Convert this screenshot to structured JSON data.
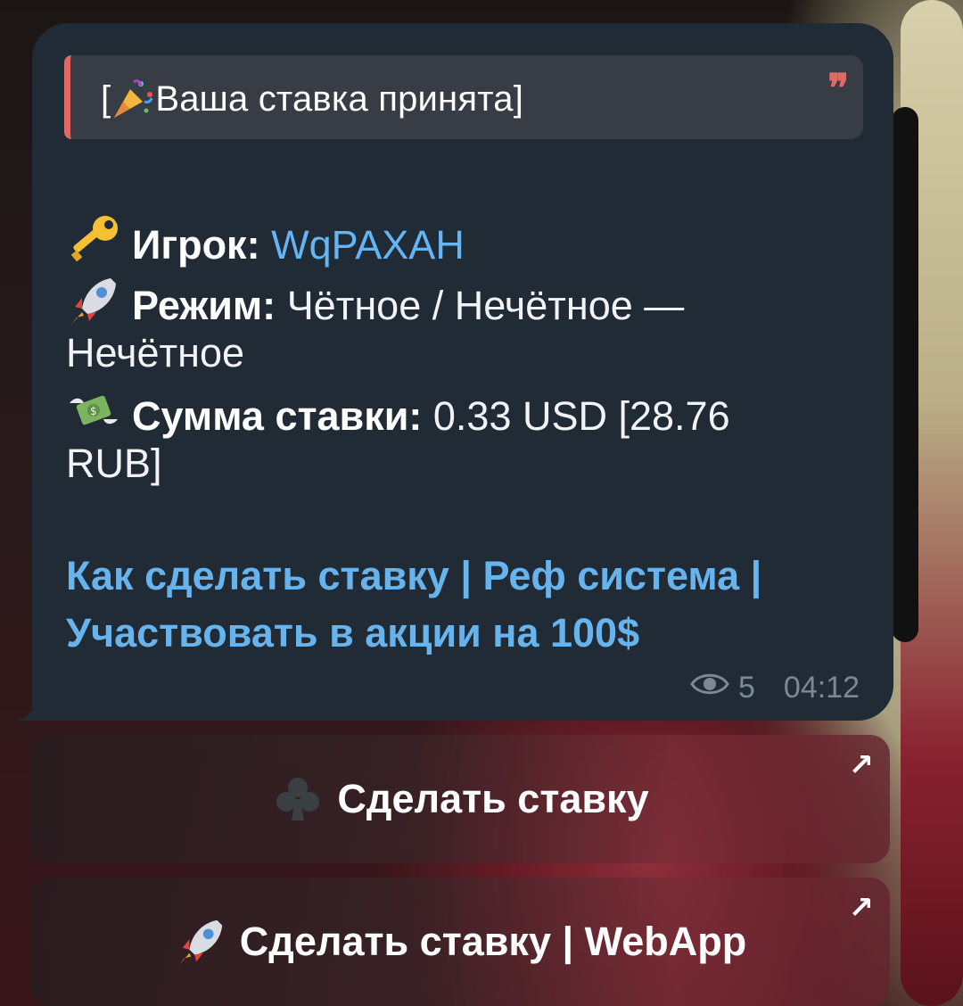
{
  "message": {
    "quote": {
      "text": "[🎉 Ваша ставка принята]",
      "bracket_open": "[",
      "title": "Ваша ставка принята",
      "bracket_close": "]",
      "emoji": "party-popper-icon",
      "mark": "❞"
    },
    "player": {
      "label": "Игрок:",
      "value": "WqPAXAH"
    },
    "mode": {
      "label": "Режим:",
      "value": "Чётное / Нечётное —",
      "value_cont": "Нечётное"
    },
    "amount": {
      "label": "Сумма ставки:",
      "value": "0.33 USD [28.76",
      "value_cont": "RUB]"
    },
    "links": {
      "how_to_bet": "Как сделать ставку",
      "separator": "|",
      "ref_system": "Реф система",
      "promo": "Участвовать в акции на 100$"
    },
    "views": "5",
    "time": "04:12"
  },
  "keyboard": {
    "buttons": [
      {
        "label": "Сделать ставку",
        "icon": "club-icon",
        "corner_icon": "↗"
      },
      {
        "label": "Сделать ставку | WebApp",
        "icon": "rocket-icon",
        "corner_icon": "↗"
      }
    ]
  },
  "colors": {
    "bubble": "#212b35",
    "quote_accent": "#e06a63",
    "link": "#66b3ee",
    "meta": "#7b8895"
  }
}
